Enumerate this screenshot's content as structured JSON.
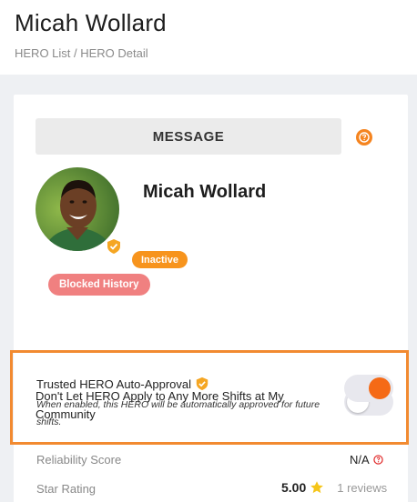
{
  "header": {
    "title": "Micah Wollard",
    "breadcrumb": "HERO List / HERO Detail"
  },
  "profile": {
    "message_button": "MESSAGE",
    "name": "Micah Wollard",
    "status": "Inactive",
    "blocked_history": "Blocked History"
  },
  "settings": {
    "dont_let_apply": {
      "label": "Don't Let HERO Apply to Any More Shifts at My Community",
      "enabled": false
    },
    "trusted_auto_approval": {
      "label": "Trusted HERO Auto-Approval",
      "description": "When enabled, this HERO will be automatically approved for future shifts.",
      "enabled": true
    }
  },
  "stats": {
    "reliability": {
      "label": "Reliability Score",
      "value": "N/A"
    },
    "star_rating": {
      "label": "Star Rating",
      "value": "5.00",
      "reviews": "1 reviews"
    }
  },
  "colors": {
    "accent": "#f5841f",
    "toggle_on": "#f56a16",
    "blocked": "#f08080",
    "highlight_border": "#f28a30"
  }
}
